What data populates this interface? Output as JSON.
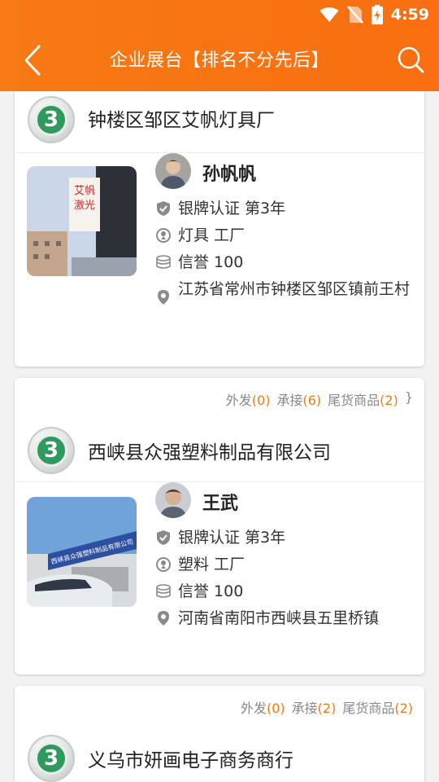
{
  "status": {
    "time": "4:59"
  },
  "nav": {
    "title": "企业展台【排名不分先后】"
  },
  "colors": {
    "accent": "#f87a14",
    "count": "#f07a14"
  },
  "stat_labels": {
    "outgoing": "外发",
    "accept": "承接",
    "stock": "尾货商品"
  },
  "companies": [
    {
      "name": "钟楼区邹区艾帆灯具厂",
      "contact": "孙帆帆",
      "cert": "银牌认证 第3年",
      "category": "灯具  工厂",
      "credit": "信誉 100",
      "address": "江苏省常州市钟楼区邹区镇前王村",
      "photo_text": "艾帆激光"
    },
    {
      "name": "西峡县众强塑料制品有限公司",
      "stats": {
        "outgoing": "(0)",
        "accept": "(6)",
        "stock": "(2)"
      },
      "contact": "王武",
      "cert": "银牌认证 第3年",
      "category": "塑料  工厂",
      "credit": "信誉 100",
      "address": "河南省南阳市西峡县五里桥镇",
      "photo_text": "西峡县众强塑料制品有限公司"
    },
    {
      "name": "义乌市妍画电子商务商行",
      "stats": {
        "outgoing": "(0)",
        "accept": "(2)",
        "stock": "(2)"
      }
    }
  ],
  "icons": [
    "back-arrow-icon",
    "search-icon",
    "wifi-icon",
    "no-sim-icon",
    "battery-charging-icon",
    "shield-check-icon",
    "location-pin-icon",
    "coins-icon"
  ]
}
